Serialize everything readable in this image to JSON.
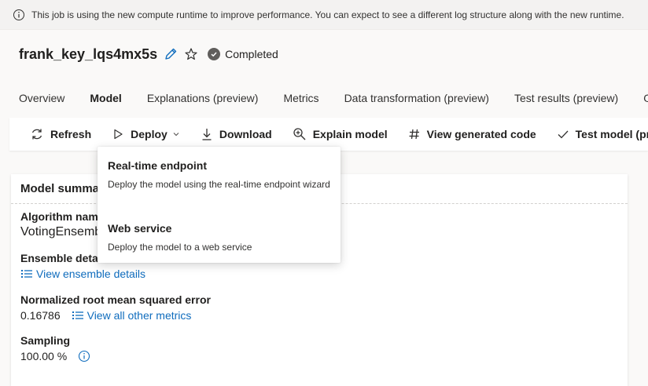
{
  "banner": {
    "text": "This job is using the new compute runtime to improve performance. You can expect to see a different log structure along with the new runtime."
  },
  "job": {
    "title": "frank_key_lqs4mx5s",
    "status": "Completed"
  },
  "tabs": [
    {
      "label": "Overview"
    },
    {
      "label": "Model"
    },
    {
      "label": "Explanations (preview)"
    },
    {
      "label": "Metrics"
    },
    {
      "label": "Data transformation (preview)"
    },
    {
      "label": "Test results (preview)"
    },
    {
      "label": "Ou"
    }
  ],
  "toolbar": {
    "refresh": "Refresh",
    "deploy": "Deploy",
    "download": "Download",
    "explain": "Explain model",
    "code": "View generated code",
    "test": "Test model (prev"
  },
  "model_summary": {
    "header": "Model summa",
    "algorithm_label": "Algorithm nam",
    "algorithm_value": "VotingEnsemb",
    "ensemble_label": "Ensemble detai",
    "ensemble_link": "View ensemble details",
    "nrmse_label": "Normalized root mean squared error",
    "nrmse_value": "0.16786",
    "metrics_link": "View all other metrics",
    "sampling_label": "Sampling",
    "sampling_value": "100.00 %"
  },
  "deploy_menu": {
    "items": [
      {
        "title": "Real-time endpoint",
        "description": "Deploy the model using the real-time endpoint wizard"
      },
      {
        "title": "Web service",
        "description": "Deploy the model to a web service"
      }
    ]
  },
  "colors": {
    "accent": "#0078d4",
    "link": "#0f6cbd",
    "status": "#605e5c"
  }
}
